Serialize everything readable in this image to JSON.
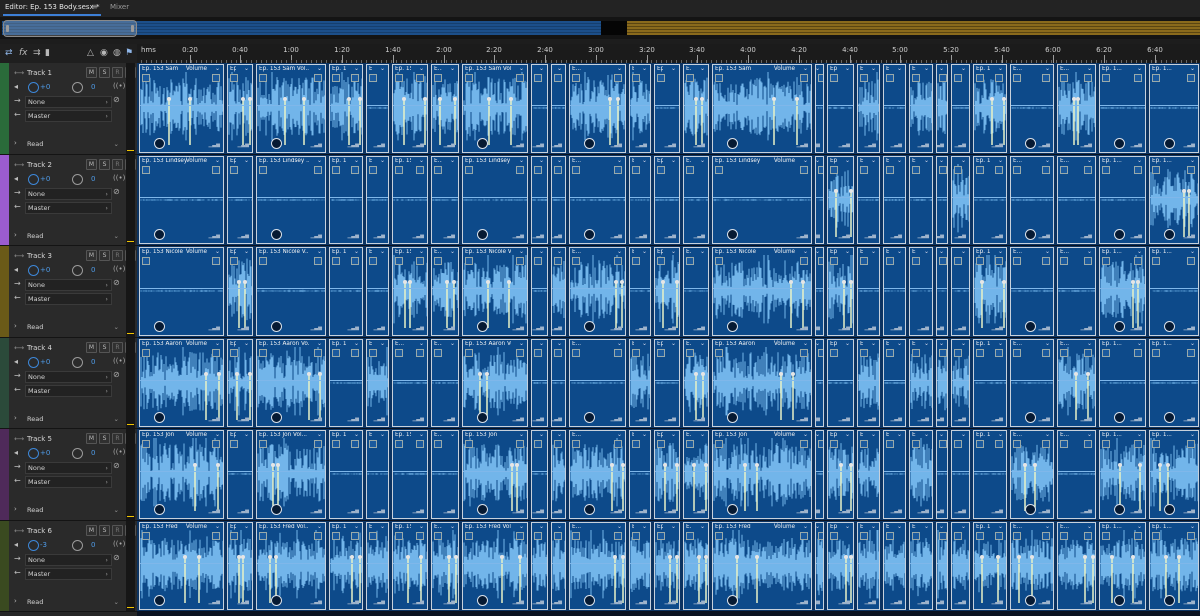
{
  "tabs": {
    "editor_label": "Editor: Ep. 153 Body.sesx *",
    "menu_glyph": "≡",
    "mixer_label": "Mixer"
  },
  "ruler": {
    "unit": "hms",
    "labels": [
      "0:20",
      "0:40",
      "1:00",
      "1:20",
      "1:40",
      "2:00",
      "2:20",
      "2:40",
      "3:00",
      "3:20",
      "3:40",
      "4:00",
      "4:20",
      "4:40",
      "5:00",
      "5:20",
      "5:40",
      "6:00",
      "6:20",
      "6:40"
    ]
  },
  "toolbar": {
    "icons": [
      "swap-icon",
      "fx-icon",
      "routing-icon",
      "eq-icon",
      "metronome-icon",
      "record-icon",
      "monitor-icon",
      "marker-icon"
    ]
  },
  "track_defaults": {
    "mute": "M",
    "solo": "S",
    "record": "R",
    "input_monitor": "I",
    "input": "None",
    "output": "Master",
    "automation_mode": "Read"
  },
  "colors": {
    "accent": "#3d7fd6",
    "clip": "#0d4a8a",
    "waveform": "#7ec1f5",
    "meter_peak": "#f0c400",
    "overview_blue": "#1c4f8a",
    "overview_gold": "#8a6a1c"
  },
  "tracks": [
    {
      "name": "Track 1",
      "volume": "+0",
      "pan": "0",
      "color": "#2a6b3a",
      "clips": [
        [
          "Ep. 153 Sam",
          "Volume"
        ],
        [
          "Ep. 15...",
          ""
        ],
        [
          "Ep. 153 Sam Vol...",
          ""
        ],
        [
          "Ep. 1...",
          ""
        ],
        [
          "Ep. 1...",
          ""
        ],
        [
          "Ep. 153...",
          ""
        ],
        [
          "E...",
          ""
        ],
        [
          "Ep. 153 Sam Vol...",
          ""
        ],
        [
          "Ep. 1...",
          ""
        ],
        [
          "Ep. ...",
          ""
        ],
        [
          "E...",
          ""
        ],
        [
          "E...",
          ""
        ],
        [
          "Ep. 15...",
          ""
        ],
        [
          "E...",
          ""
        ],
        [
          "Ep. 153 Sam",
          "Volume"
        ],
        [
          "Ep. ...",
          ""
        ],
        [
          "Ep. 1...",
          ""
        ],
        [
          "Ep. 153 Sam",
          "Volume"
        ],
        [
          "Ep. 1...",
          ""
        ],
        [
          "E...",
          ""
        ],
        [
          "Ep. 1...",
          ""
        ],
        [
          "Ep. 1...",
          ""
        ],
        [
          "Ep. 1...",
          ""
        ],
        [
          "E...",
          ""
        ],
        [
          "E...",
          ""
        ],
        [
          "Ep. 1...",
          ""
        ],
        [
          "Ep. 1...",
          ""
        ]
      ]
    },
    {
      "name": "Track 2",
      "volume": "+0",
      "pan": "0",
      "color": "#9b5ccf",
      "clips": [
        [
          "Ep. 153 Lindsey",
          "Volume"
        ],
        [
          "Ep. 15...",
          ""
        ],
        [
          "Ep. 153 Lindsey ...",
          ""
        ],
        [
          "Ep. 1...",
          ""
        ],
        [
          "Ep. 1...",
          ""
        ],
        [
          "Ep. 153...",
          ""
        ],
        [
          "E...",
          ""
        ],
        [
          "Ep. 153 Lindsey Vo...",
          ""
        ],
        [
          "Ep. 1...",
          ""
        ],
        [
          "Ep. ...",
          ""
        ],
        [
          "E...",
          ""
        ],
        [
          "E...",
          ""
        ],
        [
          "Ep. 15...",
          ""
        ],
        [
          "E...",
          ""
        ],
        [
          "Ep. 153 Lindsey",
          "Volume"
        ],
        [
          "Ep. ...",
          ""
        ],
        [
          "Ep. 1...",
          ""
        ],
        [
          "Ep. 153 Lindsey Vo...",
          ""
        ],
        [
          "Ep. 1...",
          ""
        ],
        [
          "E...",
          ""
        ],
        [
          "Ep. 1...",
          ""
        ],
        [
          "Ep. 1...",
          ""
        ],
        [
          "Ep. 1...",
          ""
        ],
        [
          "E...",
          ""
        ],
        [
          "E...",
          ""
        ],
        [
          "Ep. 1...",
          ""
        ],
        [
          "Ep. 1...",
          ""
        ]
      ]
    },
    {
      "name": "Track 3",
      "volume": "+0",
      "pan": "0",
      "color": "#6a5a18",
      "clips": [
        [
          "Ep. 153 Nicole",
          "Volume"
        ],
        [
          "Ep. 15...",
          ""
        ],
        [
          "Ep. 153 Nicole V...",
          ""
        ],
        [
          "Ep. 1...",
          ""
        ],
        [
          "Ep. 1...",
          ""
        ],
        [
          "Ep. 153...",
          ""
        ],
        [
          "E...",
          ""
        ],
        [
          "Ep. 153 Nicole Vol...",
          ""
        ],
        [
          "Ep. 1...",
          ""
        ],
        [
          "Ep. ...",
          ""
        ],
        [
          "E...",
          ""
        ],
        [
          "E...",
          ""
        ],
        [
          "Ep. 15...",
          ""
        ],
        [
          "E...",
          ""
        ],
        [
          "Ep. 153 Nicole",
          "Volume"
        ],
        [
          "Ep. ...",
          ""
        ],
        [
          "Ep. 1...",
          ""
        ],
        [
          "Ep. 153 Nicole Vo...",
          ""
        ],
        [
          "Ep. 1...",
          ""
        ],
        [
          "E...",
          ""
        ],
        [
          "Ep. 1...",
          ""
        ],
        [
          "Ep. 1...",
          ""
        ],
        [
          "Ep. 1...",
          ""
        ],
        [
          "E...",
          ""
        ],
        [
          "E...",
          ""
        ],
        [
          "Ep. 1...",
          ""
        ],
        [
          "Ep. 1...",
          ""
        ]
      ]
    },
    {
      "name": "Track 4",
      "volume": "+0",
      "pan": "0",
      "color": "#2b4a3a",
      "clips": [
        [
          "Ep. 153 Aaron",
          "Volume"
        ],
        [
          "Ep. 15...",
          ""
        ],
        [
          "Ep. 153 Aaron Vo...",
          ""
        ],
        [
          "Ep. 1...",
          ""
        ],
        [
          "Ep. 1...",
          ""
        ],
        [
          "E...",
          ""
        ],
        [
          "E...",
          ""
        ],
        [
          "Ep. 153 Aaron Vo...",
          ""
        ],
        [
          "Ep. 1...",
          ""
        ],
        [
          "Ep. ...",
          ""
        ],
        [
          "E...",
          ""
        ],
        [
          "E...",
          ""
        ],
        [
          "Ep. 15...",
          ""
        ],
        [
          "E...",
          ""
        ],
        [
          "Ep. 153 Aaron",
          "Volume"
        ],
        [
          "Ep. ...",
          ""
        ],
        [
          "Ep. 1...",
          ""
        ],
        [
          "Ep. 153 Aaron Vol...",
          ""
        ],
        [
          "Ep. 1...",
          ""
        ],
        [
          "E...",
          ""
        ],
        [
          "Ep. 1...",
          ""
        ],
        [
          "Ep. 1...",
          ""
        ],
        [
          "Ep. 1...",
          ""
        ],
        [
          "E...",
          ""
        ],
        [
          "E...",
          ""
        ],
        [
          "Ep. 1...",
          ""
        ],
        [
          "Ep. 1...",
          ""
        ]
      ]
    },
    {
      "name": "Track 5",
      "volume": "+0",
      "pan": "0",
      "color": "#4f2a5a",
      "clips": [
        [
          "Ep. 153 Jon",
          "Volume"
        ],
        [
          "Ep. 15...",
          ""
        ],
        [
          "Ep. 153 Jon Vol...",
          ""
        ],
        [
          "Ep. 1...",
          ""
        ],
        [
          "Ep. 1...",
          ""
        ],
        [
          "Ep. 153 ...",
          ""
        ],
        [
          "E...",
          ""
        ],
        [
          "Ep. 153 Jon",
          "Volume"
        ],
        [
          "Ep. 1...",
          ""
        ],
        [
          "Ep. ...",
          ""
        ],
        [
          "E...",
          ""
        ],
        [
          "E...",
          ""
        ],
        [
          "Ep. 15...",
          ""
        ],
        [
          "E...",
          ""
        ],
        [
          "Ep. 153 Jon",
          "Volume"
        ],
        [
          "Ep. ...",
          ""
        ],
        [
          "Ep. 1...",
          ""
        ],
        [
          "Ep. 153 Jon",
          "Volume"
        ],
        [
          "Ep. 1...",
          ""
        ],
        [
          "E...",
          ""
        ],
        [
          "Ep. 1...",
          ""
        ],
        [
          "Ep. 1...",
          ""
        ],
        [
          "Ep. 1...",
          ""
        ],
        [
          "E...",
          ""
        ],
        [
          "E...",
          ""
        ],
        [
          "Ep. 1...",
          ""
        ],
        [
          "Ep. 1...",
          ""
        ]
      ]
    },
    {
      "name": "Track 6",
      "volume": "-3",
      "pan": "0",
      "color": "#3a4a20",
      "clips": [
        [
          "Ep. 153 Fred",
          "Volume"
        ],
        [
          "Ep. 15...",
          ""
        ],
        [
          "Ep. 153 Fred Vol...",
          ""
        ],
        [
          "Ep. 1...",
          ""
        ],
        [
          "Ep. 1...",
          ""
        ],
        [
          "Ep. 153...",
          ""
        ],
        [
          "E...",
          ""
        ],
        [
          "Ep. 153 Fred Volu...",
          ""
        ],
        [
          "Ep. 1...",
          ""
        ],
        [
          "Ep. ...",
          ""
        ],
        [
          "E...",
          ""
        ],
        [
          "E...",
          ""
        ],
        [
          "Ep. 15...",
          ""
        ],
        [
          "E...",
          ""
        ],
        [
          "Ep. 153 Fred",
          "Volume"
        ],
        [
          "Ep. ...",
          ""
        ],
        [
          "Ep. 1...",
          ""
        ],
        [
          "Ep. 153 Fred",
          "Volume"
        ],
        [
          "Ep. 1...",
          ""
        ],
        [
          "E...",
          ""
        ],
        [
          "Ep. 1...",
          ""
        ],
        [
          "Ep. 1...",
          ""
        ],
        [
          "Ep. 1...",
          ""
        ],
        [
          "E...",
          ""
        ],
        [
          "E...",
          ""
        ],
        [
          "Ep. 1...",
          ""
        ],
        [
          "Ep. 1...",
          ""
        ]
      ]
    }
  ]
}
